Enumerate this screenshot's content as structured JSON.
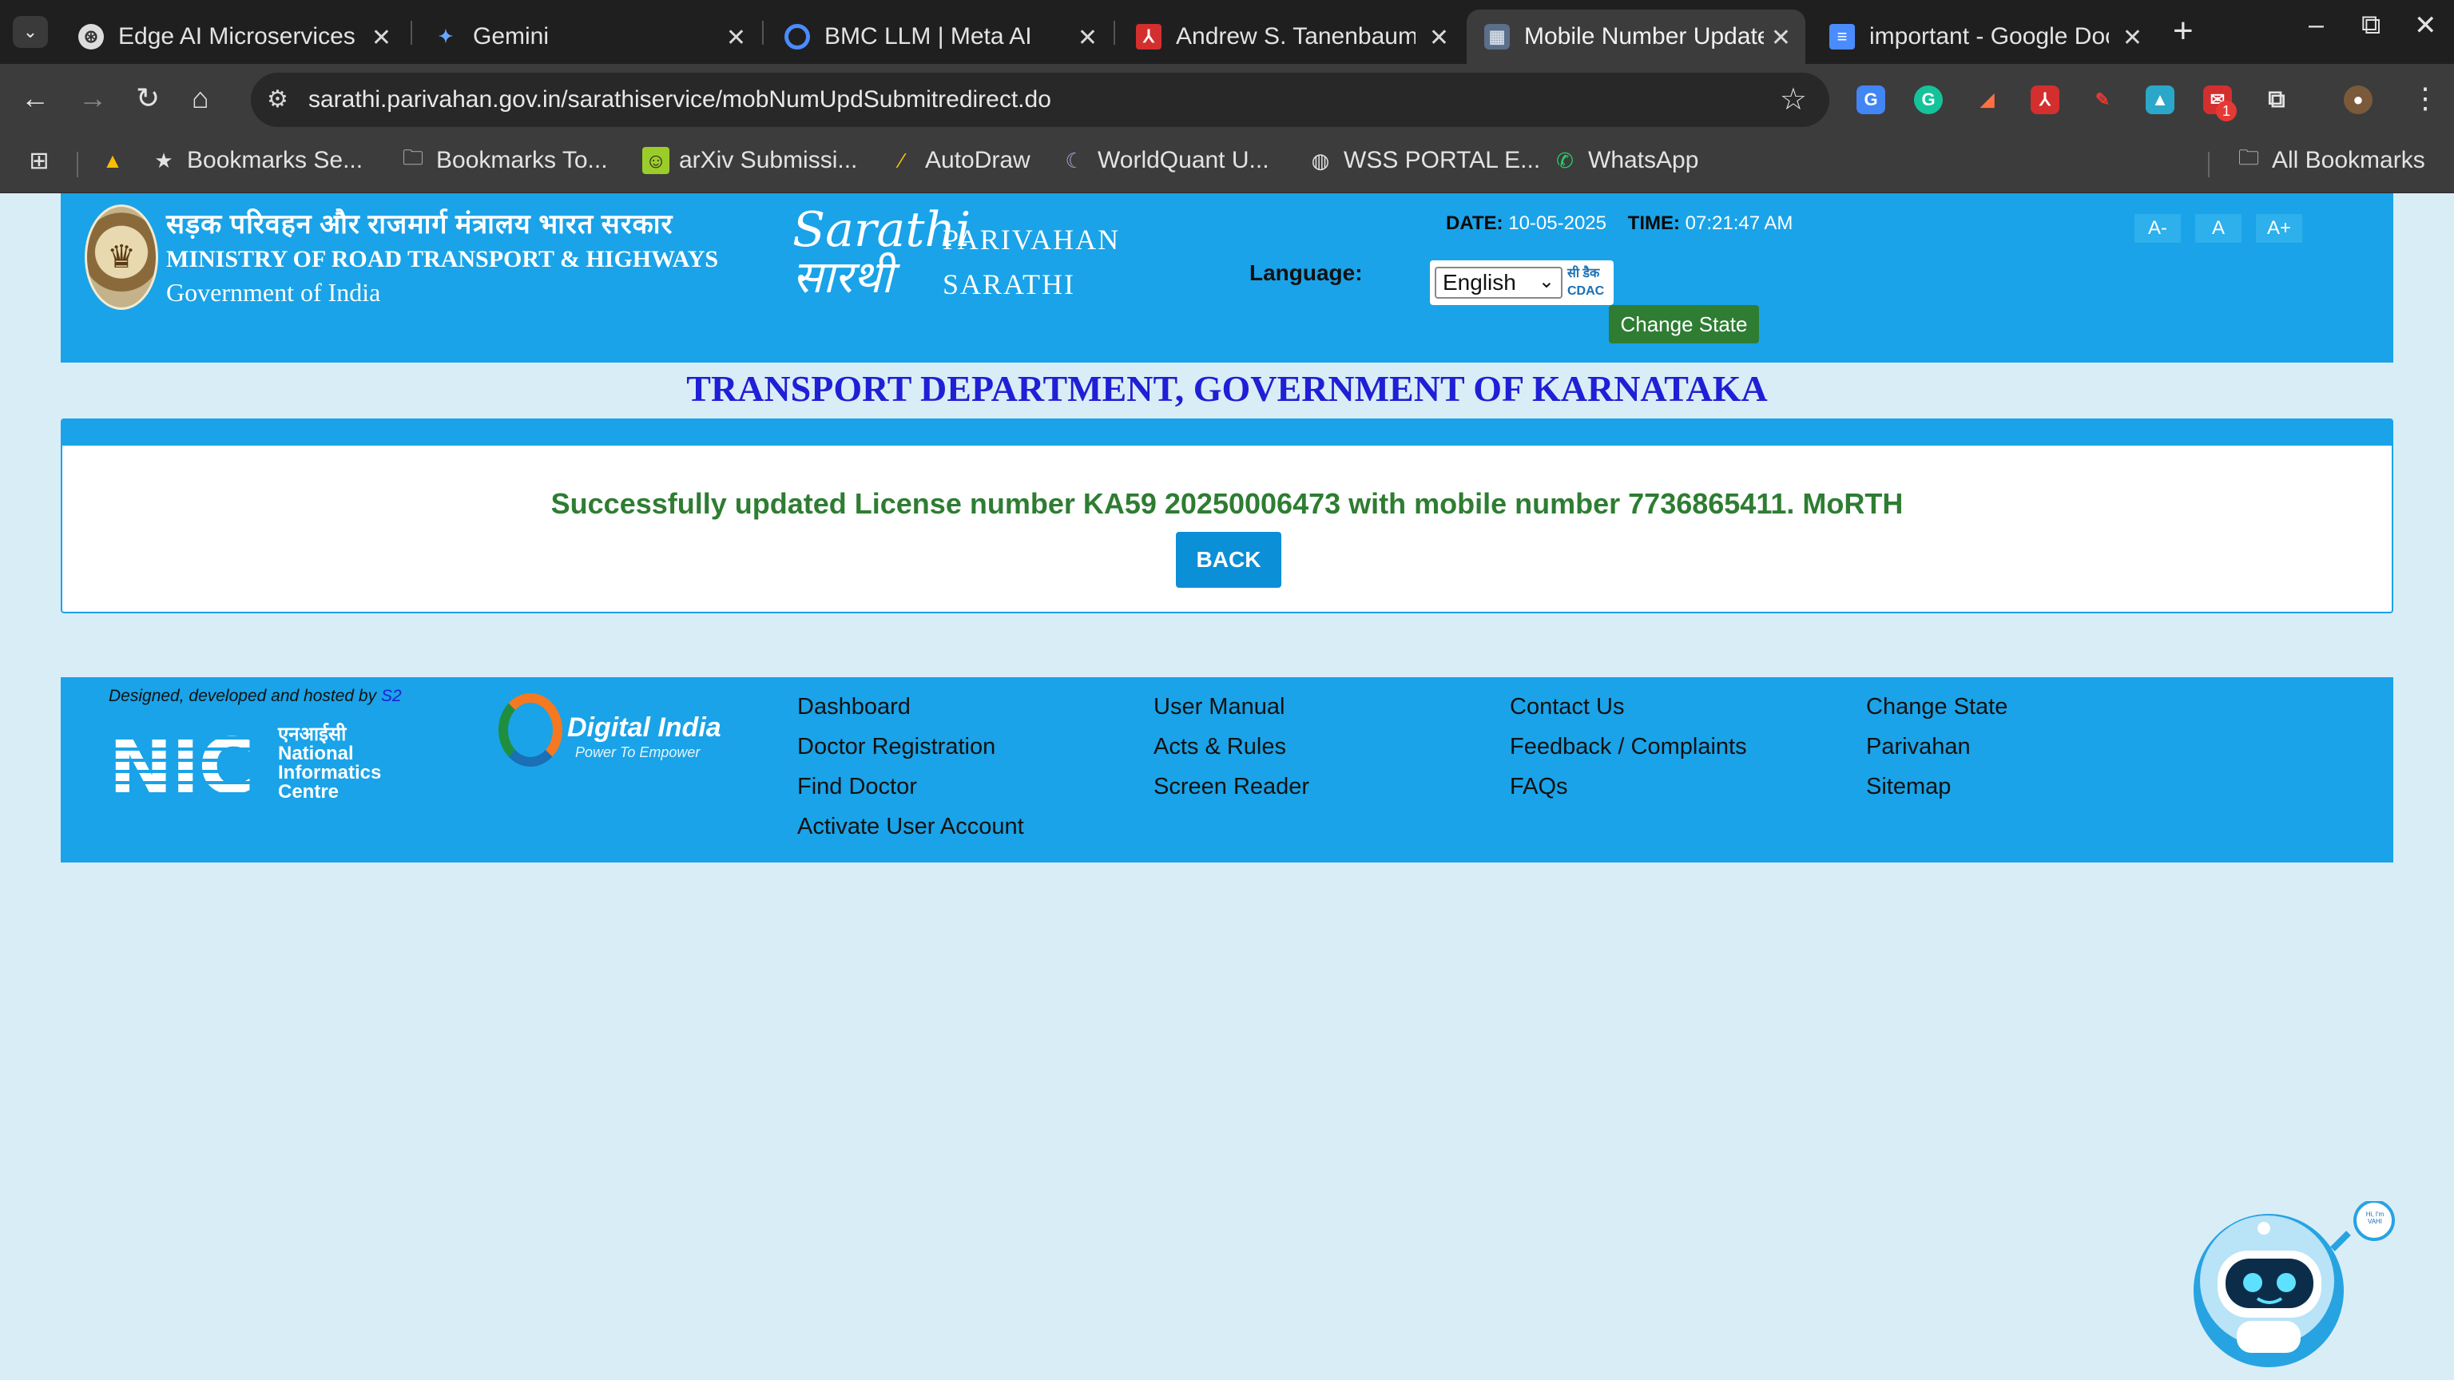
{
  "browser": {
    "tabs": [
      {
        "title": "Edge AI Microservices",
        "active": false
      },
      {
        "title": "Gemini",
        "active": false
      },
      {
        "title": "BMC LLM | Meta AI",
        "active": false
      },
      {
        "title": "Andrew S. Tanenbaum",
        "active": false
      },
      {
        "title": "Mobile Number Update",
        "active": true
      },
      {
        "title": "important - Google Docs",
        "active": false
      }
    ],
    "url": "sarathi.parivahan.gov.in/sarathiservice/mobNumUpdSubmitredirect.do",
    "bookmarks": [
      "Bookmarks Se...",
      "Bookmarks To...",
      "arXiv Submissi...",
      "AutoDraw",
      "WorldQuant U...",
      "WSS PORTAL E...",
      "WhatsApp"
    ],
    "all_bookmarks": "All Bookmarks",
    "extension_badge": "1"
  },
  "header": {
    "ministry_hindi": "सड़क परिवहन और राजमार्ग मंत्रालय भारत सरकार",
    "ministry_english": "MINISTRY OF ROAD TRANSPORT & HIGHWAYS",
    "government": "Government of India",
    "logo_line1": "Sarathi",
    "logo_line2": "सारथी",
    "parivahan": "PARIVAHAN",
    "sarathi": "SARATHI",
    "date_label": "DATE:",
    "date_value": "10-05-2025",
    "time_label": "TIME:",
    "time_value": "07:21:47 AM",
    "font_small": "A-",
    "font_normal": "A",
    "font_large": "A+",
    "language_label": "Language:",
    "language_value": "English",
    "cdac_hi": "सी डैक",
    "cdac_en": "CDAC",
    "change_state": "Change State"
  },
  "main": {
    "department": "TRANSPORT DEPARTMENT, GOVERNMENT OF KARNATAKA",
    "message": "Successfully updated License number KA59 20250006473 with mobile number 7736865411. MoRTH",
    "back": "BACK"
  },
  "footer": {
    "designed_by": "Designed, developed and hosted by",
    "designed_by_link": "S2",
    "nic_big": "NIC",
    "nic_hindi": "एनआईसी",
    "nic_line1": "National",
    "nic_line2": "Informatics",
    "nic_line3": "Centre",
    "digital_india": "Digital India",
    "digital_india_tagline": "Power To Empower",
    "col1": [
      "Dashboard",
      "Doctor Registration",
      "Find Doctor",
      "Activate User Account"
    ],
    "col2": [
      "User Manual",
      "Acts & Rules",
      "Screen Reader"
    ],
    "col3": [
      "Contact Us",
      "Feedback / Complaints",
      "FAQs"
    ],
    "col4": [
      "Change State",
      "Parivahan",
      "Sitemap"
    ]
  },
  "chatbot": {
    "bubble": "Hi, I'm VAHI"
  }
}
